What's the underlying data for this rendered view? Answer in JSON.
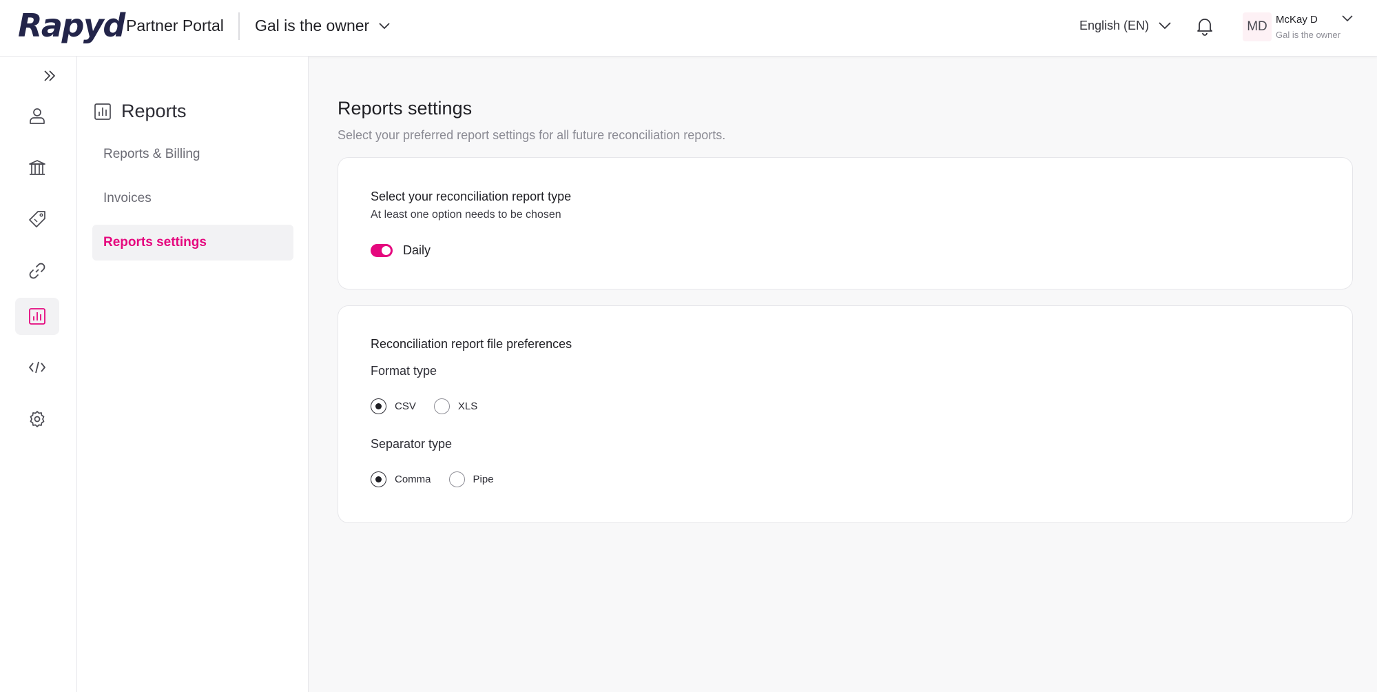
{
  "header": {
    "logo_text": "Rapyd",
    "portal_name": "Partner Portal",
    "account_name": "Gal is the owner",
    "language": "English (EN)",
    "user": {
      "initials": "MD",
      "name": "McKay D",
      "subtitle": "Gal is the owner"
    }
  },
  "rail": {
    "items": [
      {
        "icon": "user-icon"
      },
      {
        "icon": "bank-icon"
      },
      {
        "icon": "tag-icon"
      },
      {
        "icon": "link-icon"
      },
      {
        "icon": "reports-icon",
        "active": true
      },
      {
        "icon": "code-icon"
      },
      {
        "icon": "gear-icon"
      }
    ]
  },
  "subnav": {
    "title": "Reports",
    "items": [
      {
        "label": "Reports & Billing"
      },
      {
        "label": "Invoices"
      },
      {
        "label": "Reports settings",
        "active": true
      }
    ]
  },
  "main": {
    "title": "Reports settings",
    "subtitle": "Select your preferred report settings for all future reconciliation reports.",
    "report_type_card": {
      "title": "Select your reconciliation report type",
      "note": "At least one option needs to be chosen",
      "toggle_label": "Daily",
      "toggle_on": true
    },
    "file_prefs_card": {
      "title": "Reconciliation report file preferences",
      "format_label": "Format type",
      "format_options": [
        "CSV",
        "XLS"
      ],
      "format_selected": "CSV",
      "separator_label": "Separator type",
      "separator_options": [
        "Comma",
        "Pipe"
      ],
      "separator_selected": "Comma"
    }
  },
  "colors": {
    "accent": "#e5087e",
    "logo": "#23254a"
  }
}
